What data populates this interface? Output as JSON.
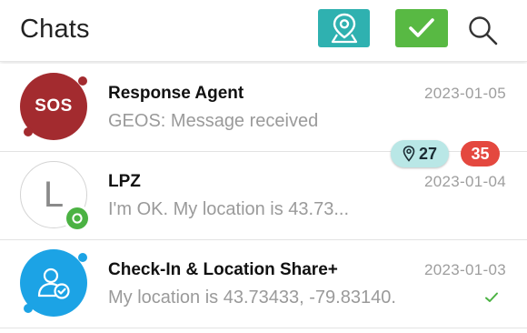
{
  "header": {
    "title": "Chats",
    "map_button_color": "#2fb1b0",
    "check_button_color": "#58b943"
  },
  "chats": [
    {
      "name": "Response Agent",
      "preview": "GEOS: Message received",
      "date": "2023-01-05",
      "avatar_text": "SOS",
      "avatar_color": "#a32b2f"
    },
    {
      "name": "LPZ",
      "preview": "I'm OK. My location is 43.73...",
      "date": "2023-01-04",
      "avatar_text": "L",
      "location_count": "27",
      "unread_count": "35",
      "presence_color": "#4bb243"
    },
    {
      "name": "Check-In & Location Share+",
      "preview": "My location is 43.73433, -79.83140.",
      "date": "2023-01-03",
      "avatar_icon": "user-check-icon",
      "avatar_color": "#1ca3e5",
      "status_icon": "delivered-check-icon"
    }
  ]
}
